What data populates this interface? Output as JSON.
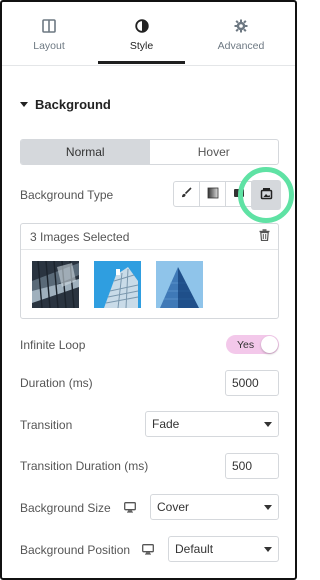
{
  "tabs": [
    {
      "label": "Layout",
      "icon": "layout-icon",
      "active": false
    },
    {
      "label": "Style",
      "icon": "style-half-circle-icon",
      "active": true
    },
    {
      "label": "Advanced",
      "icon": "gear-icon",
      "active": false
    }
  ],
  "section": {
    "title": "Background"
  },
  "state_toggle": {
    "normal": "Normal",
    "hover": "Hover",
    "active": "Normal"
  },
  "background_type": {
    "label": "Background Type",
    "options": [
      "brush-icon",
      "gradient-icon",
      "video-icon",
      "slideshow-icon"
    ],
    "selected": "slideshow-icon",
    "highlight_color": "#5fe2a4"
  },
  "gallery": {
    "status": "3 Images Selected",
    "delete_icon": "trash-icon",
    "count": 3
  },
  "infinite_loop": {
    "label": "Infinite Loop",
    "value": "Yes",
    "color": "#f3c8ea"
  },
  "duration": {
    "label": "Duration (ms)",
    "value": "5000"
  },
  "transition": {
    "label": "Transition",
    "value": "Fade"
  },
  "transition_duration": {
    "label": "Transition Duration (ms)",
    "value": "500"
  },
  "background_size": {
    "label": "Background Size",
    "value": "Cover",
    "device_icon": "desktop-monitor-icon"
  },
  "background_position": {
    "label": "Background Position",
    "value": "Default",
    "device_icon": "desktop-monitor-icon"
  }
}
